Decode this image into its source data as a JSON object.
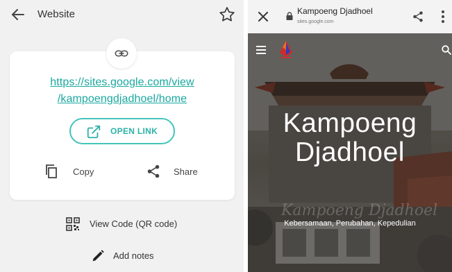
{
  "left": {
    "title": "Website",
    "url_line1": "https://sites.google.com/view",
    "url_line2": "/kampoengdjadhoel/home",
    "open_button": "OPEN LINK",
    "copy_label": "Copy",
    "share_label": "Share",
    "qr_label": "View Code (QR code)",
    "notes_label": "Add notes",
    "icons": [
      "back-arrow-icon",
      "star-icon",
      "link-icon",
      "open-external-icon",
      "copy-icon",
      "share-icon",
      "qr-code-icon",
      "pencil-icon"
    ],
    "accent_color": "#2cb2a8"
  },
  "right": {
    "page_title": "Kampoeng Djadhoel",
    "page_url": "sites.google.com",
    "hero_title_line1": "Kampoeng",
    "hero_title_line2": "Djadhoel",
    "hero_script": "Kampoeng Djadhoel",
    "hero_tagline": "Kebersamaan, Perubahan, Kepedulian",
    "icons": [
      "close-icon",
      "lock-icon",
      "share-icon",
      "more-vert-icon",
      "menu-icon",
      "search-icon"
    ]
  }
}
